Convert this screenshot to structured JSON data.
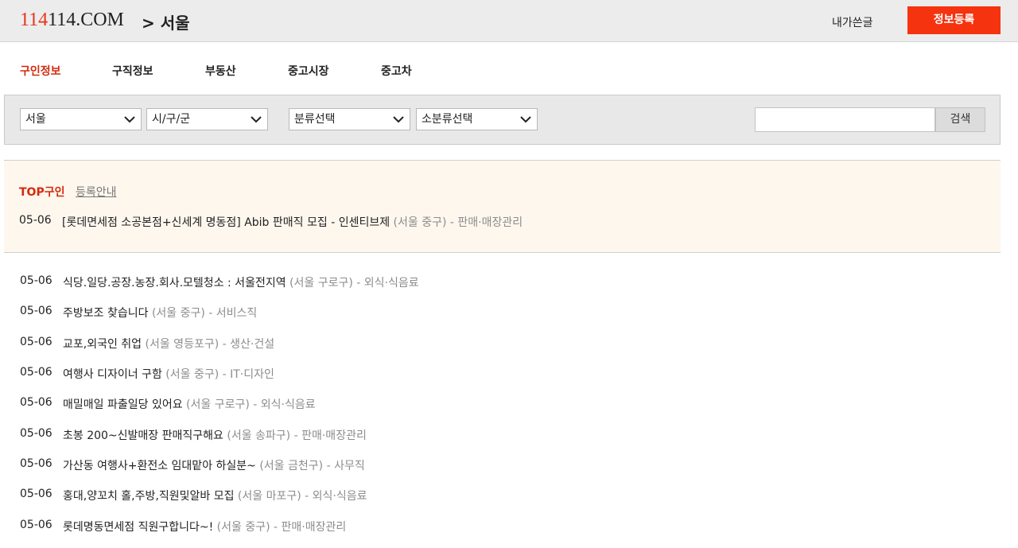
{
  "header": {
    "logo_red": "114",
    "logo_rest": "114.COM",
    "region": "> 서울",
    "my_posts": "내가쓴글",
    "register": "정보등록"
  },
  "nav": {
    "items": [
      {
        "label": "구인정보",
        "active": true
      },
      {
        "label": "구직정보"
      },
      {
        "label": "부동산"
      },
      {
        "label": "중고시장"
      },
      {
        "label": "중고차"
      }
    ]
  },
  "filters": {
    "city": "서울",
    "district": "시/구/군",
    "category": "분류선택",
    "subcategory": "소분류선택",
    "search_value": "",
    "search_button": "검색"
  },
  "top": {
    "title": "TOP구인",
    "guide": "등록안내",
    "items": [
      {
        "date": "05-06",
        "title": "[롯데면세점 소공본점+신세계 명동점] Abib 판매직 모집 - 인센티브제",
        "meta": " (서울 중구) - 판매·매장관리"
      }
    ]
  },
  "listings": [
    {
      "date": "05-06",
      "title": "식당.일당.공장.농장.회사.모텔청소 : 서울전지역",
      "meta": " (서울 구로구) - 외식·식음료"
    },
    {
      "date": "05-06",
      "title": "주방보조 찾습니다",
      "meta": " (서울 중구) - 서비스직"
    },
    {
      "date": "05-06",
      "title": "교포,외국인 취업",
      "meta": " (서울 영등포구) - 생산·건설"
    },
    {
      "date": "05-06",
      "title": "여행사 디자이너 구함",
      "meta": " (서울 중구) - IT·디자인"
    },
    {
      "date": "05-06",
      "title": "매밀매일 파출일당 있어요",
      "meta": " (서울 구로구) - 외식·식음료"
    },
    {
      "date": "05-06",
      "title": "초봉 200~신발매장 판매직구해요",
      "meta": " (서울 송파구) - 판매·매장관리"
    },
    {
      "date": "05-06",
      "title": "가산동 여행사+환전소 임대맡아 하실분~",
      "meta": " (서울 금천구) - 사무직"
    },
    {
      "date": "05-06",
      "title": "홍대,양꼬치 홀,주방,직원및알바 모집",
      "meta": " (서울 마포구) - 외식·식음료"
    },
    {
      "date": "05-06",
      "title": "롯데명동면세점 직원구합니다~!",
      "meta": " (서울 중구) - 판매·매장관리"
    }
  ],
  "colors": {
    "accent": "#f5330f",
    "active_nav": "#d42a0c",
    "meta_text": "#8c8c8c",
    "top_bg": "#fdf7ee"
  }
}
